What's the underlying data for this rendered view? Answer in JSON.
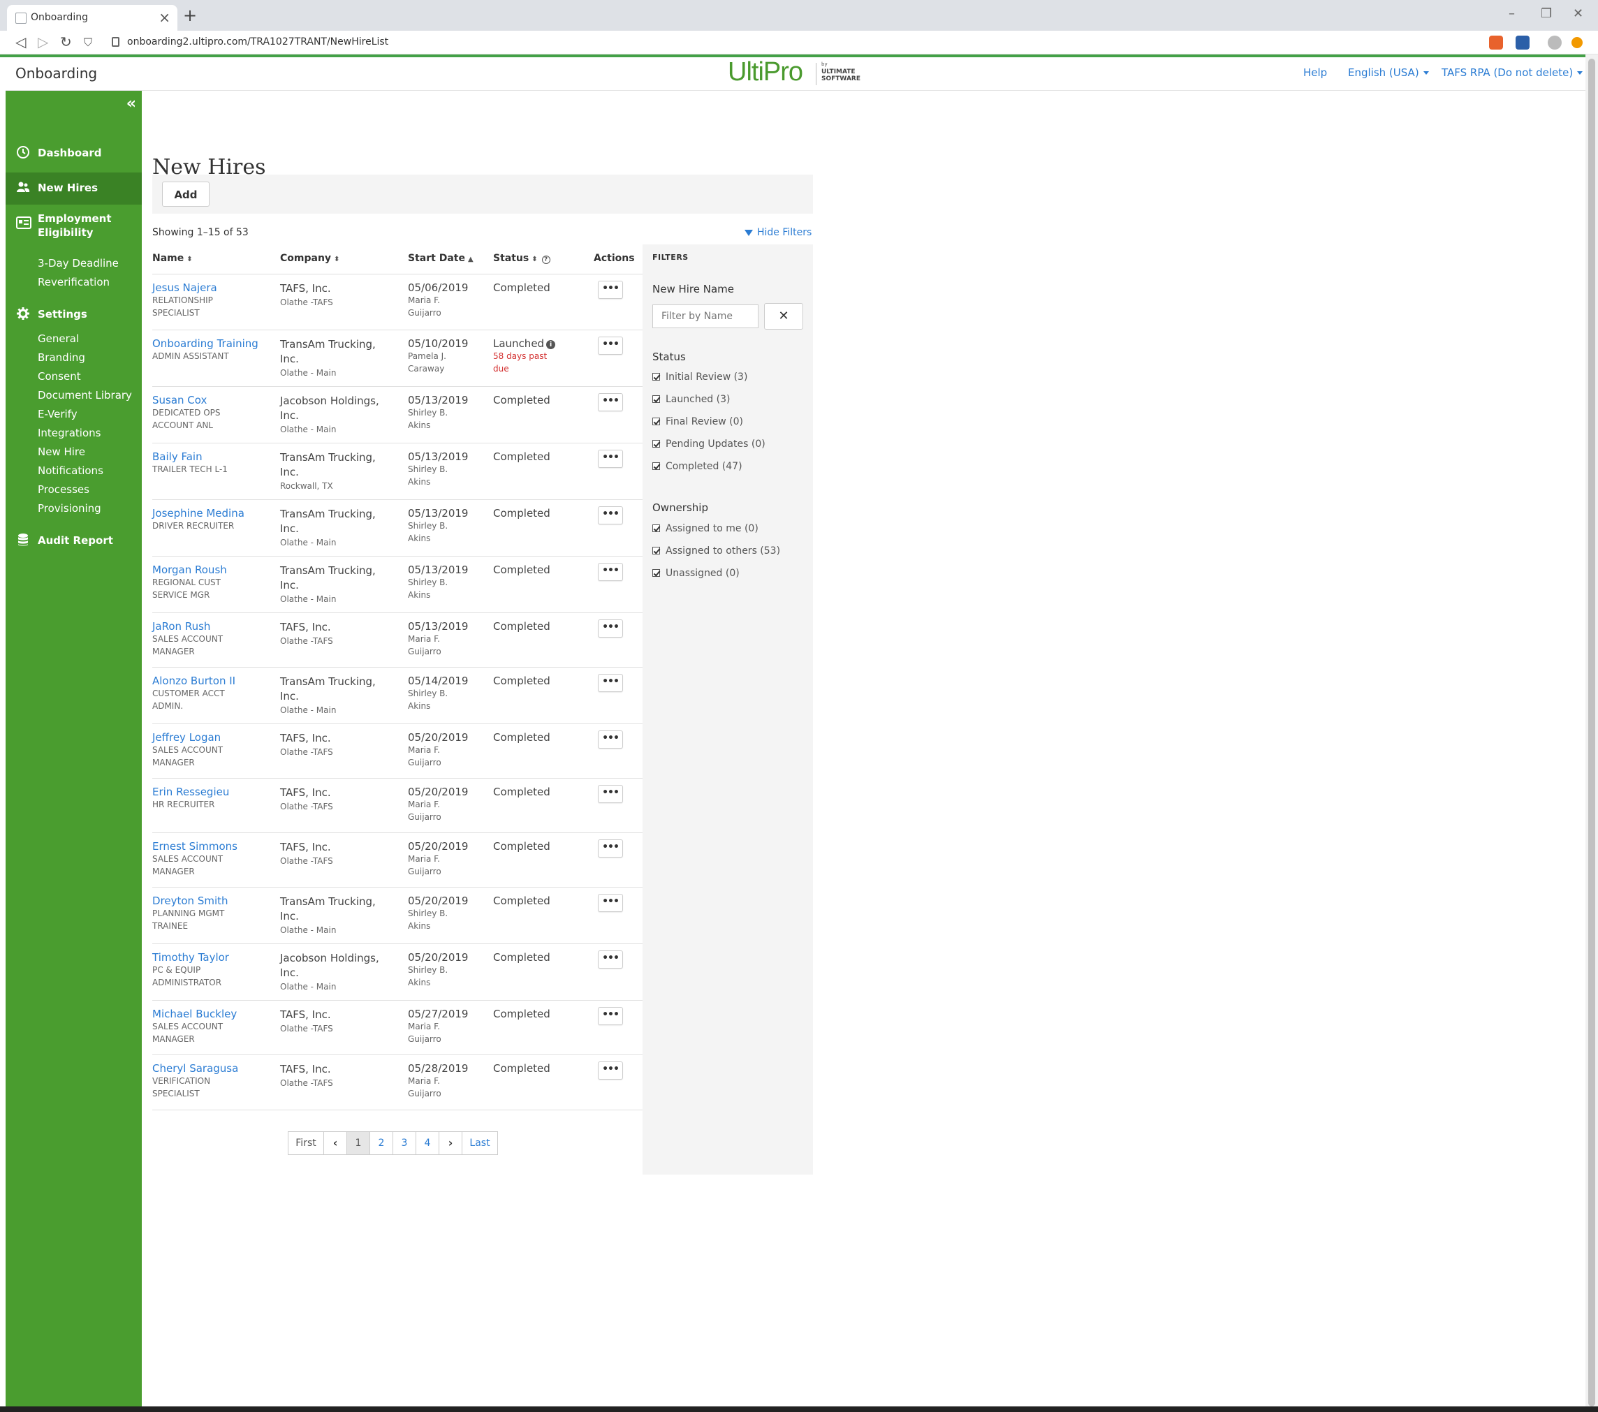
{
  "browser": {
    "tab_title": "Onboarding",
    "new_tab_symbol": "+",
    "url": "onboarding2.ultipro.com/TRA1027TRANT/NewHireList"
  },
  "header": {
    "app_title": "Onboarding",
    "logo_text": "UltiPro",
    "logo_by": "by",
    "logo_sub1": "ULTIMATE",
    "logo_sub2": "SOFTWARE",
    "help": "Help",
    "language": "English (USA)",
    "account": "TAFS RPA (Do not delete)"
  },
  "sidebar": {
    "collapse_symbol": "«",
    "dashboard": "Dashboard",
    "new_hires": "New Hires",
    "employment_line1": "Employment",
    "employment_line2": "Eligibility",
    "employment_sub": [
      "3-Day Deadline",
      "Reverification"
    ],
    "settings": "Settings",
    "settings_sub": [
      "General",
      "Branding",
      "Consent",
      "Document Library",
      "E-Verify",
      "Integrations",
      "New Hire",
      "Notifications",
      "Processes",
      "Provisioning"
    ],
    "audit_report": "Audit Report"
  },
  "main": {
    "title": "New Hires",
    "add_label": "Add",
    "showing": "Showing 1–15 of 53",
    "hide_filters": "Hide Filters",
    "columns": {
      "name": "Name",
      "company": "Company",
      "start_date": "Start Date",
      "status": "Status",
      "actions": "Actions"
    },
    "sort_both": "⬍",
    "sort_asc": "▲",
    "actions_label": "•••",
    "info_glyph": "i",
    "help_glyph": "?",
    "rows": [
      {
        "name": "Jesus Najera",
        "title": "RELATIONSHIP SPECIALIST",
        "company": "TAFS, Inc.",
        "location": "Olathe -TAFS",
        "date": "05/06/2019",
        "owner": "Maria F. Guijarro",
        "status": "Completed"
      },
      {
        "name": "Onboarding Training",
        "title": "ADMIN ASSISTANT",
        "company": "TransAm Trucking, Inc.",
        "location": "Olathe - Main",
        "date": "05/10/2019",
        "owner": "Pamela J. Caraway",
        "status": "Launched",
        "due": "58 days past due"
      },
      {
        "name": "Susan Cox",
        "title": "DEDICATED OPS ACCOUNT ANL",
        "company": "Jacobson Holdings, Inc.",
        "location": "Olathe - Main",
        "date": "05/13/2019",
        "owner": "Shirley B. Akins",
        "status": "Completed"
      },
      {
        "name": "Baily Fain",
        "title": "TRAILER TECH L-1",
        "company": "TransAm Trucking, Inc.",
        "location": "Rockwall, TX",
        "date": "05/13/2019",
        "owner": "Shirley B. Akins",
        "status": "Completed"
      },
      {
        "name": "Josephine Medina",
        "title": "DRIVER RECRUITER",
        "company": "TransAm Trucking, Inc.",
        "location": "Olathe - Main",
        "date": "05/13/2019",
        "owner": "Shirley B. Akins",
        "status": "Completed"
      },
      {
        "name": "Morgan Roush",
        "title": "REGIONAL CUST SERVICE MGR",
        "company": "TransAm Trucking, Inc.",
        "location": "Olathe - Main",
        "date": "05/13/2019",
        "owner": "Shirley B. Akins",
        "status": "Completed"
      },
      {
        "name": "JaRon Rush",
        "title": "SALES ACCOUNT MANAGER",
        "company": "TAFS, Inc.",
        "location": "Olathe -TAFS",
        "date": "05/13/2019",
        "owner": "Maria F. Guijarro",
        "status": "Completed"
      },
      {
        "name": "Alonzo Burton II",
        "title": "CUSTOMER ACCT ADMIN.",
        "company": "TransAm Trucking, Inc.",
        "location": "Olathe - Main",
        "date": "05/14/2019",
        "owner": "Shirley B. Akins",
        "status": "Completed"
      },
      {
        "name": "Jeffrey Logan",
        "title": "SALES ACCOUNT MANAGER",
        "company": "TAFS, Inc.",
        "location": "Olathe -TAFS",
        "date": "05/20/2019",
        "owner": "Maria F. Guijarro",
        "status": "Completed"
      },
      {
        "name": "Erin Ressegieu",
        "title": "HR RECRUITER",
        "company": "TAFS, Inc.",
        "location": "Olathe -TAFS",
        "date": "05/20/2019",
        "owner": "Maria F. Guijarro",
        "status": "Completed"
      },
      {
        "name": "Ernest Simmons",
        "title": "SALES ACCOUNT MANAGER",
        "company": "TAFS, Inc.",
        "location": "Olathe -TAFS",
        "date": "05/20/2019",
        "owner": "Maria F. Guijarro",
        "status": "Completed"
      },
      {
        "name": "Dreyton Smith",
        "title": "PLANNING MGMT TRAINEE",
        "company": "TransAm Trucking, Inc.",
        "location": "Olathe - Main",
        "date": "05/20/2019",
        "owner": "Shirley B. Akins",
        "status": "Completed"
      },
      {
        "name": "Timothy Taylor",
        "title": "PC & EQUIP ADMINISTRATOR",
        "company": "Jacobson Holdings, Inc.",
        "location": "Olathe - Main",
        "date": "05/20/2019",
        "owner": "Shirley B. Akins",
        "status": "Completed"
      },
      {
        "name": "Michael Buckley",
        "title": "SALES ACCOUNT MANAGER",
        "company": "TAFS, Inc.",
        "location": "Olathe -TAFS",
        "date": "05/27/2019",
        "owner": "Maria F. Guijarro",
        "status": "Completed"
      },
      {
        "name": "Cheryl Saragusa",
        "title": "VERIFICATION SPECIALIST",
        "company": "TAFS, Inc.",
        "location": "Olathe -TAFS",
        "date": "05/28/2019",
        "owner": "Maria F. Guijarro",
        "status": "Completed"
      }
    ],
    "pagination": {
      "first": "First",
      "prev": "‹",
      "pages": [
        "1",
        "2",
        "3",
        "4"
      ],
      "current": "1",
      "next": "›",
      "last": "Last"
    }
  },
  "filters": {
    "heading": "FILTERS",
    "name_label": "New Hire Name",
    "name_placeholder": "Filter by Name",
    "clear_symbol": "✕",
    "status_label": "Status",
    "status_options": [
      "Initial Review (3)",
      "Launched (3)",
      "Final Review (0)",
      "Pending Updates (0)",
      "Completed (47)"
    ],
    "ownership_label": "Ownership",
    "ownership_options": [
      "Assigned to me (0)",
      "Assigned to others (53)",
      "Unassigned (0)"
    ]
  }
}
